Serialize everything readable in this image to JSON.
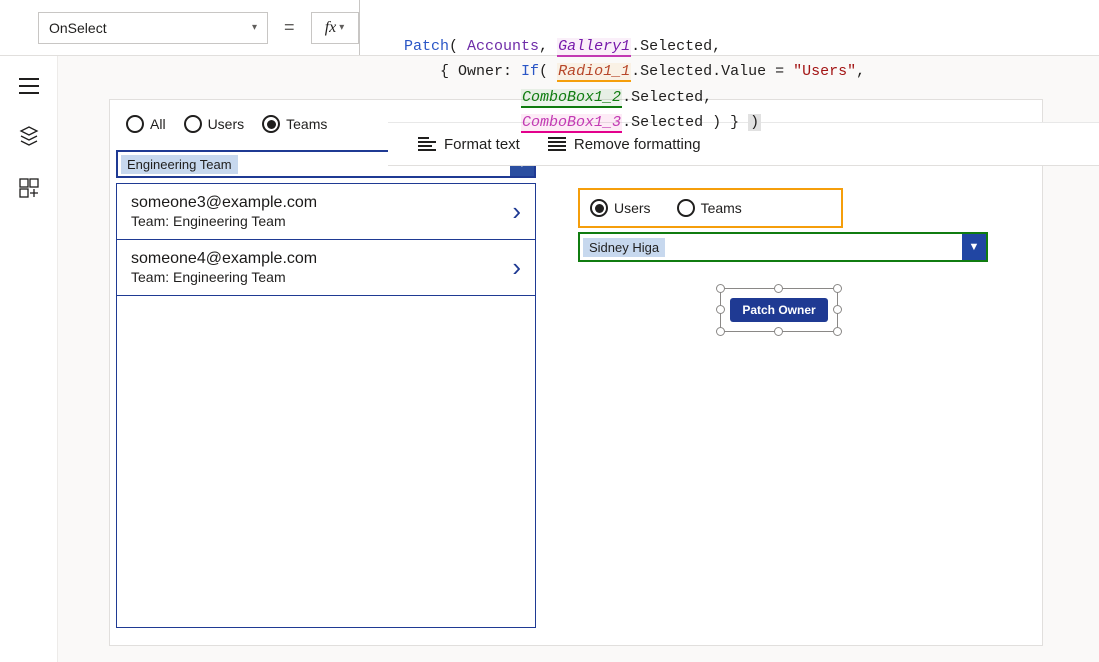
{
  "topbar": {
    "property": "OnSelect",
    "eq": "=",
    "fx": "fx"
  },
  "formula": {
    "l1a": "Patch",
    "l1b": "( ",
    "l1c": "Accounts",
    "l1d": ", ",
    "l1e": "Gallery1",
    "l1f": ".Selected,",
    "l2a": "    { Owner: ",
    "l2b": "If",
    "l2c": "( ",
    "l2d": "Radio1_1",
    "l2e": ".Selected.Value = ",
    "l2f": "\"Users\"",
    "l2g": ",",
    "l3a": "             ",
    "l3b": "ComboBox1_2",
    "l3c": ".Selected,",
    "l4a": "             ",
    "l4b": "ComboBox1_3",
    "l4c": ".Selected ) } ",
    "l4d": ")"
  },
  "toolbar": {
    "format": "Format text",
    "remove": "Remove formatting"
  },
  "radios_top": {
    "all": "All",
    "users": "Users",
    "teams": "Teams"
  },
  "radios_right": {
    "users": "Users",
    "teams": "Teams"
  },
  "dropdown_team": "Engineering Team",
  "dropdown_user": "Sidney Higa",
  "gallery": [
    {
      "title": "someone3@example.com",
      "sub": "Team: Engineering Team"
    },
    {
      "title": "someone4@example.com",
      "sub": "Team: Engineering Team"
    }
  ],
  "button": {
    "label": "Patch Owner"
  }
}
